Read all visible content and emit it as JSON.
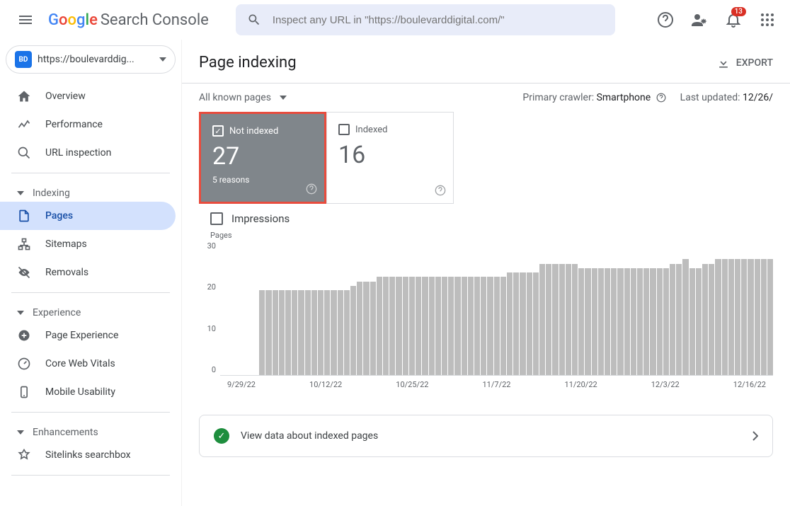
{
  "app": {
    "name": "Search Console"
  },
  "search": {
    "placeholder": "Inspect any URL in \"https://boulevarddigital.com/\""
  },
  "notifications": {
    "count": "13"
  },
  "property": {
    "icon_label": "BD",
    "url": "https://boulevarddig..."
  },
  "nav": {
    "overview": "Overview",
    "performance": "Performance",
    "url_inspection": "URL inspection",
    "indexing_section": "Indexing",
    "pages": "Pages",
    "sitemaps": "Sitemaps",
    "removals": "Removals",
    "experience_section": "Experience",
    "page_experience": "Page Experience",
    "core_web_vitals": "Core Web Vitals",
    "mobile_usability": "Mobile Usability",
    "enhancements_section": "Enhancements",
    "sitelinks_searchbox": "Sitelinks searchbox"
  },
  "page": {
    "title": "Page indexing",
    "export": "EXPORT",
    "filter": "All known pages",
    "crawler_label": "Primary crawler: ",
    "crawler_value": "Smartphone",
    "updated_label": "Last updated: ",
    "updated_value": "12/26/"
  },
  "cards": {
    "not_indexed": {
      "label": "Not indexed",
      "value": "27",
      "sub": "5 reasons"
    },
    "indexed": {
      "label": "Indexed",
      "value": "16"
    }
  },
  "impressions": {
    "label": "Impressions"
  },
  "link_card": {
    "text": "View data about indexed pages"
  },
  "chart_data": {
    "type": "bar",
    "ylabel": "Pages",
    "ylim": [
      0,
      30
    ],
    "yticks": [
      "30",
      "20",
      "10",
      "0"
    ],
    "xticks": [
      "9/29/22",
      "10/12/22",
      "10/25/22",
      "11/7/22",
      "11/20/22",
      "12/3/22",
      "12/16/22"
    ],
    "values": [
      0,
      0,
      0,
      0,
      0,
      0,
      19,
      19,
      19,
      19,
      19,
      19,
      19,
      19,
      19,
      19,
      19,
      19,
      19,
      19,
      20,
      21,
      21,
      21,
      22,
      22,
      22,
      22,
      22,
      22,
      22,
      22,
      22,
      22,
      22,
      22,
      22,
      22,
      22,
      22,
      22,
      22,
      22,
      22,
      23,
      23,
      23,
      23,
      23,
      25,
      25,
      25,
      25,
      25,
      25,
      24,
      24,
      24,
      24,
      24,
      24,
      24,
      24,
      24,
      24,
      24,
      24,
      24,
      24,
      25,
      25,
      26,
      24,
      24,
      25,
      25,
      26,
      26,
      26,
      26,
      26,
      26,
      26,
      26,
      26
    ]
  }
}
